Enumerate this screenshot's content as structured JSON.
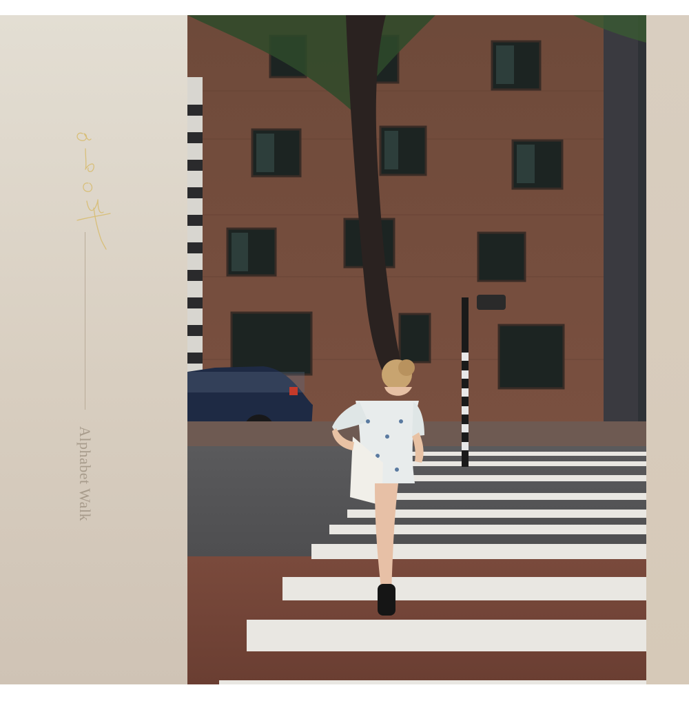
{
  "sidebar": {
    "script_word": "about",
    "title": "Alphabet Walk"
  },
  "photo": {
    "subject": "woman-crossing-street",
    "icon": "photograph"
  },
  "colors": {
    "background": "#ffffff",
    "panel": "#dcd3c6",
    "accent_gold": "#d8bf7a",
    "text_muted": "#a89c8c"
  }
}
